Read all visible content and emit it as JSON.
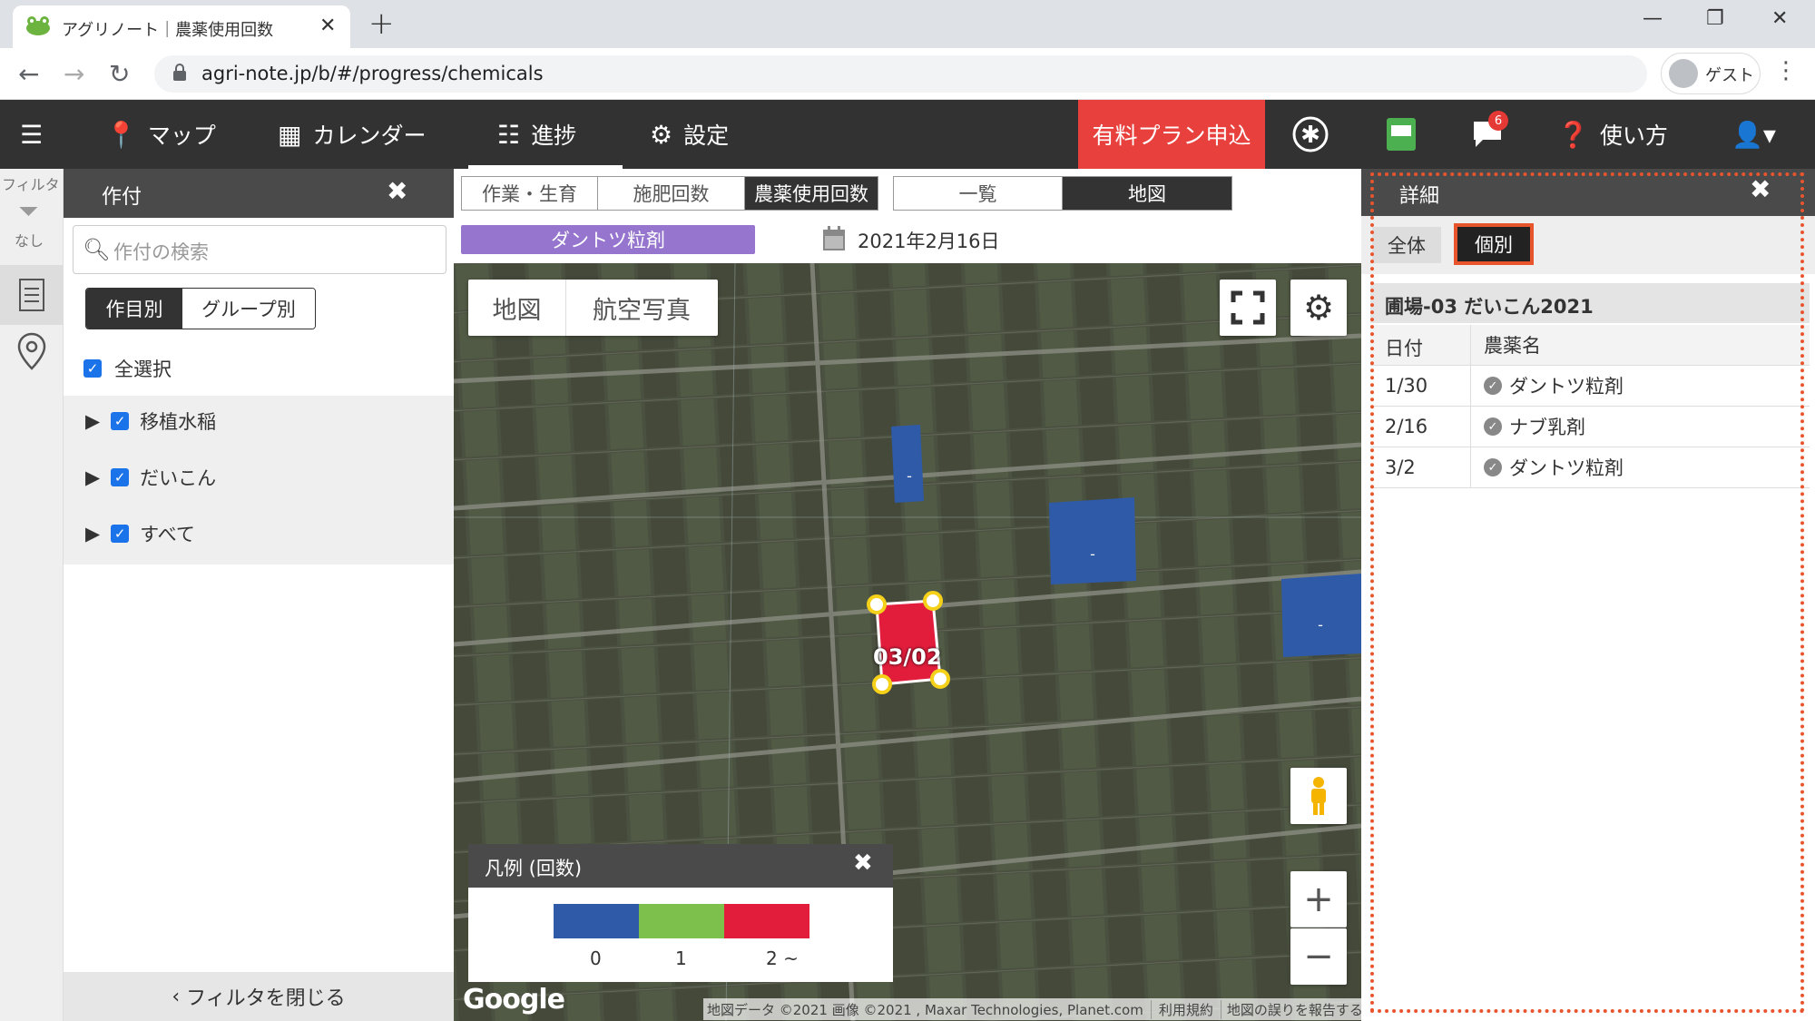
{
  "browser": {
    "tab_title": "アグリノート｜農薬使用回数",
    "url": "agri-note.jp/b/#/progress/chemicals",
    "profile_name": "ゲスト",
    "new_tab": "+",
    "tab_close": "✕",
    "win_min": "—",
    "win_max": "❐",
    "win_close": "✕"
  },
  "app_nav": {
    "map": "マップ",
    "calendar": "カレンダー",
    "progress": "進捗",
    "settings": "設定",
    "premium": "有料プラン申込",
    "notification_count": "6",
    "help": "使い方"
  },
  "filter_strip": {
    "label": "フィルタ",
    "status": "なし"
  },
  "left_panel": {
    "title": "作付",
    "close": "✖",
    "search_placeholder": "作付の検索",
    "seg_by_item": "作目別",
    "seg_by_group": "グループ別",
    "select_all": "全選択",
    "tree": [
      {
        "label": "移植水稲"
      },
      {
        "label": "だいこん"
      },
      {
        "label": "すべて"
      }
    ],
    "close_filter": "フィルタを閉じる"
  },
  "center": {
    "tabs": [
      "作業・生育",
      "施肥回数",
      "農薬使用回数"
    ],
    "views": [
      "一覧",
      "地図"
    ],
    "chemical_chip": "ダントツ粒剤",
    "date": "2021年2月16日"
  },
  "map": {
    "type_map": "地図",
    "type_aerial": "航空写真",
    "field_label": "03/02",
    "dash": "-",
    "legend_title": "凡例 (回数)",
    "legend_close": "✖",
    "legend_labels": [
      "0",
      "1",
      "2 ~"
    ],
    "legend_colors": [
      "#2e5aa8",
      "#7dc04b",
      "#e21d3c"
    ],
    "google": "Google",
    "attribution": [
      "地図データ ©2021 画像 ©2021 , Maxar Technologies, Planet.com",
      "利用規約",
      "地図の誤りを報告する"
    ],
    "zoom_in": "+",
    "zoom_out": "−"
  },
  "right_panel": {
    "title": "詳細",
    "close": "✖",
    "tab_all": "全体",
    "tab_individual": "個別",
    "field_name": "圃場-03 だいこん2021",
    "col_date": "日付",
    "col_chem": "農薬名",
    "rows": [
      {
        "date": "1/30",
        "chem": "ダントツ粒剤"
      },
      {
        "date": "2/16",
        "chem": "ナブ乳剤"
      },
      {
        "date": "3/2",
        "chem": "ダントツ粒剤"
      }
    ]
  },
  "colors": {
    "accent_red": "#e8403d",
    "nav_dark": "#323232",
    "highlight": "#e8552d"
  }
}
